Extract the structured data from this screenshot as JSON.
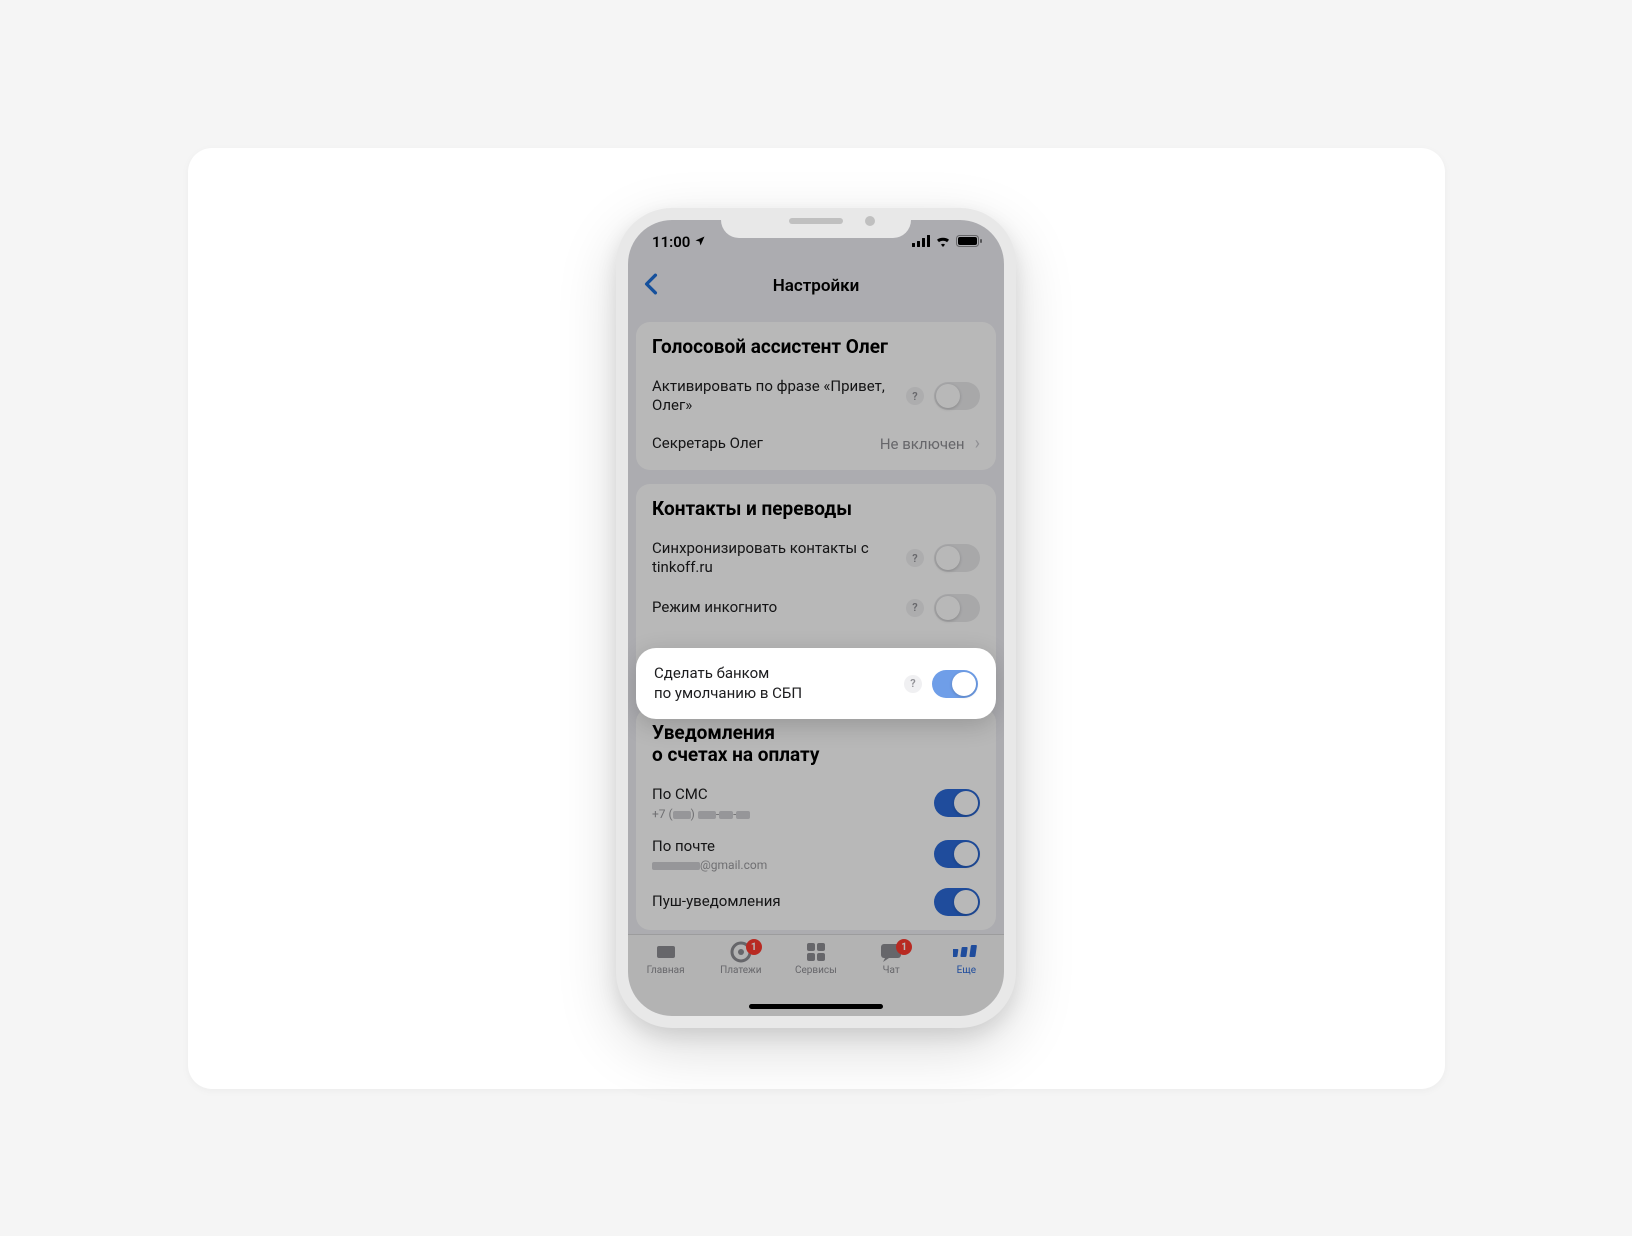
{
  "status": {
    "time": "11:00",
    "location_icon": "location-arrow"
  },
  "nav": {
    "title": "Настройки"
  },
  "sections": {
    "assistant": {
      "title": "Голосовой ассистент Олег",
      "activate_label": "Активировать по фразе «Привет, Олег»",
      "secretary_label": "Секретарь Олег",
      "secretary_value": "Не включен"
    },
    "contacts": {
      "title": "Контакты и переводы",
      "sync_label": "Синхронизировать контакты с tinkoff.ru",
      "incognito_label": "Режим инкогнито",
      "sbp_label_line1": "Сделать банком",
      "sbp_label_line2": "по умолчанию в СБП"
    },
    "notifications": {
      "title_line1": "Уведомления",
      "title_line2": "о счетах на оплату",
      "sms_label": "По СМС",
      "sms_sub_prefix": "+7 (",
      "sms_sub_suffix": ")",
      "email_label": "По почте",
      "email_domain": "@gmail.com",
      "push_label": "Пуш-уведомления"
    }
  },
  "tabs": {
    "home": "Главная",
    "payments": "Платежи",
    "services": "Сервисы",
    "chat": "Чат",
    "more": "Еще",
    "payments_badge": "1",
    "chat_badge": "1"
  }
}
